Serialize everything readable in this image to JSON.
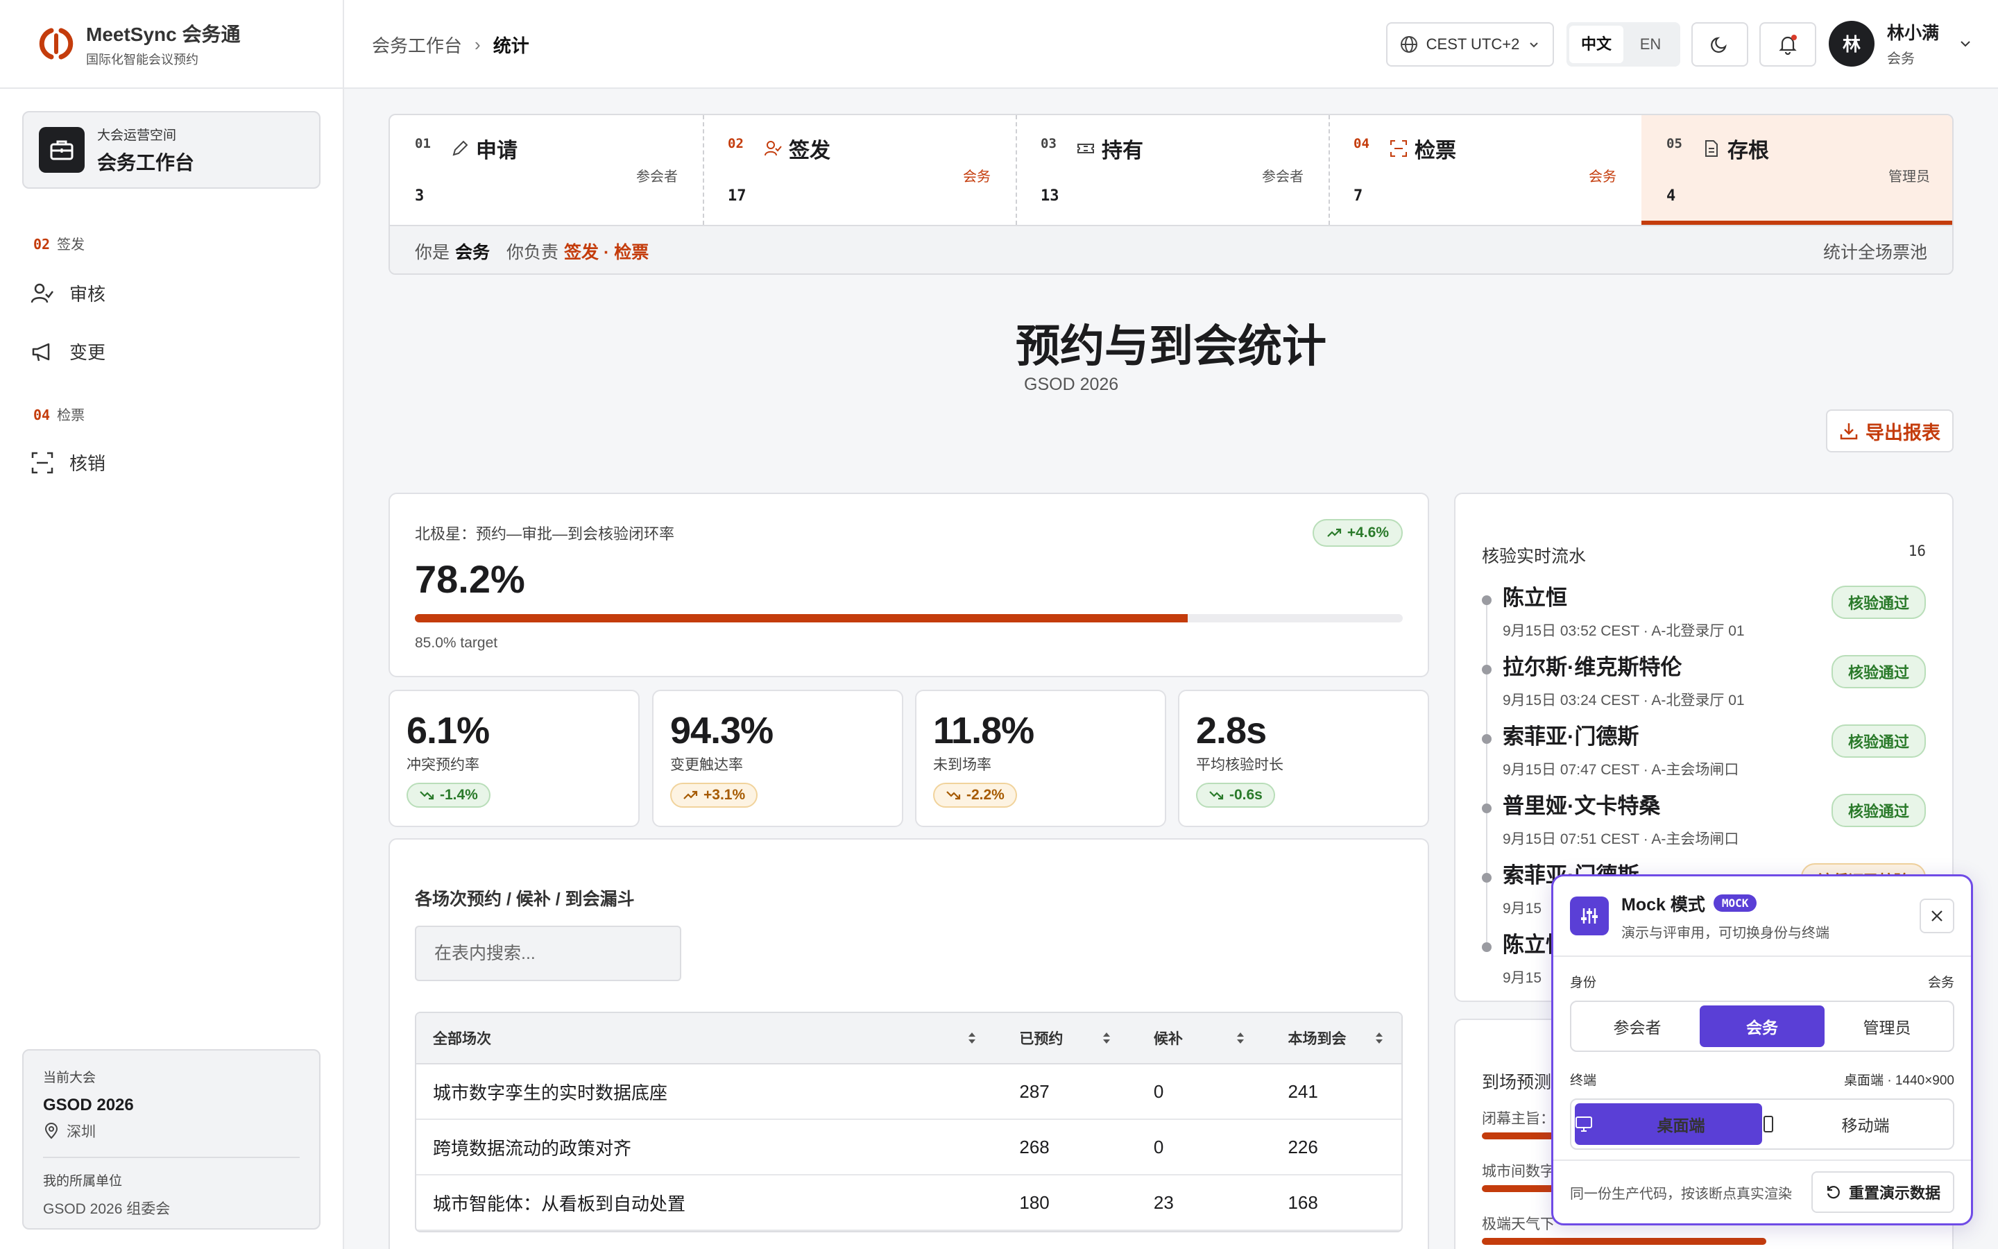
{
  "brand": {
    "name": "MeetSync 会务通",
    "tagline": "国际化智能会议预约",
    "accent": "#c43c0c"
  },
  "workspace": {
    "label": "大会运营空间",
    "title": "会务工作台"
  },
  "nav": {
    "sections": [
      {
        "num": "02",
        "label": "签发",
        "items": [
          {
            "label": "审核",
            "icon": "user-check-icon"
          },
          {
            "label": "变更",
            "icon": "megaphone-icon"
          }
        ]
      },
      {
        "num": "04",
        "label": "检票",
        "items": [
          {
            "label": "核销",
            "icon": "scan-icon"
          }
        ]
      }
    ]
  },
  "event": {
    "current_label": "当前大会",
    "name": "GSOD 2026",
    "city": "深圳",
    "org_label": "我的所属单位",
    "org": "GSOD 2026 组委会"
  },
  "header": {
    "breadcrumb": [
      "会务工作台",
      "统计"
    ],
    "timezone": "CEST UTC+2",
    "lang": [
      "中文",
      "EN"
    ],
    "user": {
      "initial": "林",
      "name": "林小满",
      "role": "会务"
    }
  },
  "stepper": {
    "steps": [
      {
        "num": "01",
        "title": "申请",
        "role": "参会者",
        "count": "3",
        "icon": "pen-icon"
      },
      {
        "num": "02",
        "title": "签发",
        "role": "会务",
        "count": "17",
        "icon": "user-check-icon"
      },
      {
        "num": "03",
        "title": "持有",
        "role": "参会者",
        "count": "13",
        "icon": "ticket-icon"
      },
      {
        "num": "04",
        "title": "检票",
        "role": "会务",
        "count": "7",
        "icon": "scan-icon"
      },
      {
        "num": "05",
        "title": "存根",
        "role": "管理员",
        "count": "4",
        "icon": "doc-icon"
      }
    ],
    "you_are": "你是",
    "you_role": "会务",
    "you_duty_label": "你负责",
    "you_duty": "签发 · 检票",
    "right": "统计全场票池"
  },
  "page": {
    "title": "预约与到会统计",
    "subtitle": "GSOD 2026",
    "export": "导出报表"
  },
  "north_star": {
    "label": "北极星：预约—审批—到会核验闭环率",
    "value": "78.2%",
    "progress": 0.782,
    "target": "85.0% target",
    "delta": "+4.6%"
  },
  "kpis": [
    {
      "value": "6.1%",
      "label": "冲突预约率",
      "delta": "-1.4%",
      "tone": "good",
      "dir": "down"
    },
    {
      "value": "94.3%",
      "label": "变更触达率",
      "delta": "+3.1%",
      "tone": "warn",
      "dir": "up"
    },
    {
      "value": "11.8%",
      "label": "未到场率",
      "delta": "-2.2%",
      "tone": "warn",
      "dir": "down"
    },
    {
      "value": "2.8s",
      "label": "平均核验时长",
      "delta": "-0.6s",
      "tone": "good",
      "dir": "down"
    }
  ],
  "funnel": {
    "title": "各场次预约 / 候补 / 到会漏斗",
    "search_placeholder": "在表内搜索...",
    "columns": [
      "全部场次",
      "已预约",
      "候补",
      "本场到会"
    ],
    "rows": [
      [
        "城市数字孪生的实时数据底座",
        "287",
        "0",
        "241"
      ],
      [
        "跨境数据流动的政策对齐",
        "268",
        "0",
        "226"
      ],
      [
        "城市智能体：从看板到自动处置",
        "180",
        "23",
        "168"
      ]
    ]
  },
  "flow": {
    "title": "核验实时流水",
    "count": "16",
    "items": [
      {
        "name": "陈立恒",
        "meta": "9月15日 03:52 CEST · A-北登录厅 01",
        "status": "核验通过",
        "tone": "ok"
      },
      {
        "name": "拉尔斯·维克斯特伦",
        "meta": "9月15日 03:24 CEST · A-北登录厅 01",
        "status": "核验通过",
        "tone": "ok"
      },
      {
        "name": "索菲亚·门德斯",
        "meta": "9月15日 07:47 CEST · A-主会场闸口",
        "status": "核验通过",
        "tone": "ok"
      },
      {
        "name": "普里娅·文卡特桑",
        "meta": "9月15日 07:51 CEST · A-主会场闸口",
        "status": "核验通过",
        "tone": "ok"
      },
      {
        "name": "索菲亚·门德斯",
        "meta": "9月15",
        "status": "该凭证已核验",
        "tone": "warn"
      },
      {
        "name": "陈立恒",
        "meta": "9月15",
        "status": "",
        "tone": "ok"
      }
    ]
  },
  "forecast": {
    "title": "到场预测",
    "rows": [
      "闭幕主旨：",
      "城市间数字",
      "极端天气下"
    ]
  },
  "mock": {
    "title": "Mock 模式",
    "tag": "MOCK",
    "subtitle": "演示与评审用，可切换身份与终端",
    "identity_label": "身份",
    "identity_value": "会务",
    "identities": [
      "参会者",
      "会务",
      "管理员"
    ],
    "terminal_label": "终端",
    "terminal_value": "桌面端 · 1440×900",
    "terminals": [
      "桌面端",
      "移动端"
    ],
    "footer": "同一份生产代码，按该断点真实渲染",
    "reset": "重置演示数据"
  }
}
